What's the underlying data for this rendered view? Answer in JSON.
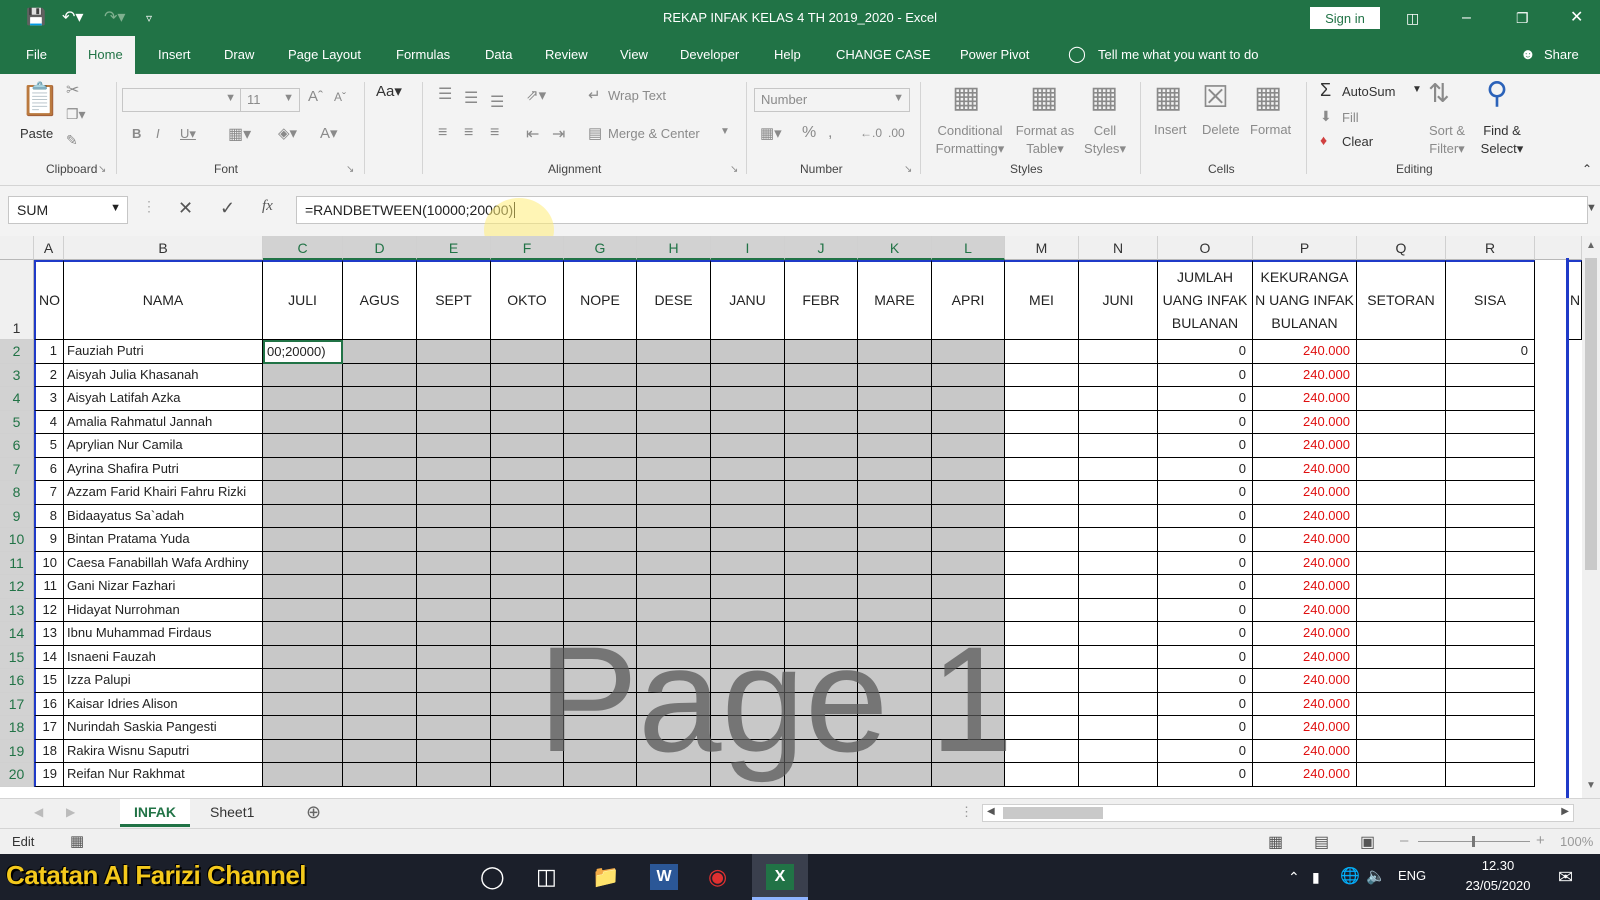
{
  "app": {
    "title": "REKAP INFAK KELAS 4 TH 2019_2020  -  Excel",
    "sign_in": "Sign in"
  },
  "menu": [
    "File",
    "Home",
    "Insert",
    "Draw",
    "Page Layout",
    "Formulas",
    "Data",
    "Review",
    "View",
    "Developer",
    "Help",
    "CHANGE CASE",
    "Power Pivot"
  ],
  "tell_me": "Tell me what you want to do",
  "share": "Share",
  "ribbon": {
    "paste": "Paste",
    "font_size": "11",
    "wrap_text": "Wrap Text",
    "merge_center": "Merge & Center",
    "number_format": "Number",
    "conditional_formatting": [
      "Conditional",
      "Formatting"
    ],
    "format_as_table": [
      "Format as",
      "Table"
    ],
    "cell_styles": [
      "Cell",
      "Styles"
    ],
    "insert": "Insert",
    "delete": "Delete",
    "format": "Format",
    "autosum": "AutoSum",
    "fill": "Fill",
    "clear": "Clear",
    "sort_filter": [
      "Sort &",
      "Filter"
    ],
    "find_select": [
      "Find &",
      "Select"
    ],
    "groups": {
      "clipboard": "Clipboard",
      "font": "Font",
      "alignment": "Alignment",
      "number": "Number",
      "styles": "Styles",
      "cells": "Cells",
      "editing": "Editing"
    }
  },
  "formula_bar": {
    "name_box": "SUM",
    "formula": "=RANDBETWEEN(10000;20000)",
    "fx": "fx"
  },
  "sheet": {
    "columns": [
      "A",
      "B",
      "C",
      "D",
      "E",
      "F",
      "G",
      "H",
      "I",
      "J",
      "K",
      "L",
      "M",
      "N",
      "O",
      "P",
      "Q",
      "R"
    ],
    "headers": [
      "NO",
      "NAMA",
      "JULI",
      "AGUS",
      "SEPT",
      "OKTO",
      "NOPE",
      "DESE",
      "JANU",
      "FEBR",
      "MARE",
      "APRI",
      "MEI",
      "JUNI",
      "JUMLAH UANG INFAK BULANAN",
      "KEKURANGA N UANG INFAK BULANAN",
      "SETORAN",
      "SISA"
    ],
    "extra_col_header": "N",
    "editing_cell_text": "00;20000)",
    "rows": [
      {
        "row": "2",
        "no": "1",
        "name": "Fauziah Putri",
        "jumlah": "0",
        "kurang": "240.000",
        "sisa": "0"
      },
      {
        "row": "3",
        "no": "2",
        "name": "Aisyah Julia Khasanah",
        "jumlah": "0",
        "kurang": "240.000",
        "sisa": ""
      },
      {
        "row": "4",
        "no": "3",
        "name": "Aisyah Latifah Azka",
        "jumlah": "0",
        "kurang": "240.000",
        "sisa": ""
      },
      {
        "row": "5",
        "no": "4",
        "name": "Amalia Rahmatul Jannah",
        "jumlah": "0",
        "kurang": "240.000",
        "sisa": ""
      },
      {
        "row": "6",
        "no": "5",
        "name": "Aprylian Nur Camila",
        "jumlah": "0",
        "kurang": "240.000",
        "sisa": ""
      },
      {
        "row": "7",
        "no": "6",
        "name": "Ayrina Shafira Putri",
        "jumlah": "0",
        "kurang": "240.000",
        "sisa": ""
      },
      {
        "row": "8",
        "no": "7",
        "name": "Azzam Farid Khairi Fahru Rizki",
        "jumlah": "0",
        "kurang": "240.000",
        "sisa": ""
      },
      {
        "row": "9",
        "no": "8",
        "name": "Bidaayatus Sa`adah",
        "jumlah": "0",
        "kurang": "240.000",
        "sisa": ""
      },
      {
        "row": "10",
        "no": "9",
        "name": "Bintan Pratama Yuda",
        "jumlah": "0",
        "kurang": "240.000",
        "sisa": ""
      },
      {
        "row": "11",
        "no": "10",
        "name": "Caesa Fanabillah Wafa Ardhiny",
        "jumlah": "0",
        "kurang": "240.000",
        "sisa": ""
      },
      {
        "row": "12",
        "no": "11",
        "name": "Gani Nizar Fazhari",
        "jumlah": "0",
        "kurang": "240.000",
        "sisa": ""
      },
      {
        "row": "13",
        "no": "12",
        "name": "Hidayat Nurrohman",
        "jumlah": "0",
        "kurang": "240.000",
        "sisa": ""
      },
      {
        "row": "14",
        "no": "13",
        "name": "Ibnu Muhammad Firdaus",
        "jumlah": "0",
        "kurang": "240.000",
        "sisa": ""
      },
      {
        "row": "15",
        "no": "14",
        "name": "Isnaeni Fauzah",
        "jumlah": "0",
        "kurang": "240.000",
        "sisa": ""
      },
      {
        "row": "16",
        "no": "15",
        "name": "Izza Palupi",
        "jumlah": "0",
        "kurang": "240.000",
        "sisa": ""
      },
      {
        "row": "17",
        "no": "16",
        "name": "Kaisar Idries Alison",
        "jumlah": "0",
        "kurang": "240.000",
        "sisa": ""
      },
      {
        "row": "18",
        "no": "17",
        "name": "Nurindah Saskia Pangesti",
        "jumlah": "0",
        "kurang": "240.000",
        "sisa": ""
      },
      {
        "row": "19",
        "no": "18",
        "name": "Rakira Wisnu Saputri",
        "jumlah": "0",
        "kurang": "240.000",
        "sisa": ""
      },
      {
        "row": "20",
        "no": "19",
        "name": "Reifan Nur Rakhmat",
        "jumlah": "0",
        "kurang": "240.000",
        "sisa": ""
      }
    ],
    "watermark": "Page 1"
  },
  "tabs": [
    "INFAK",
    "Sheet1"
  ],
  "status": {
    "mode": "Edit",
    "zoom": "100%"
  },
  "taskbar": {
    "channel": "Catatan Al Farizi Channel",
    "lang": "ENG",
    "time": "12.30",
    "date": "23/05/2020"
  },
  "colors": {
    "excel_green": "#217346",
    "negative_red": "#e01010",
    "print_area_blue": "#1f3ac8"
  }
}
